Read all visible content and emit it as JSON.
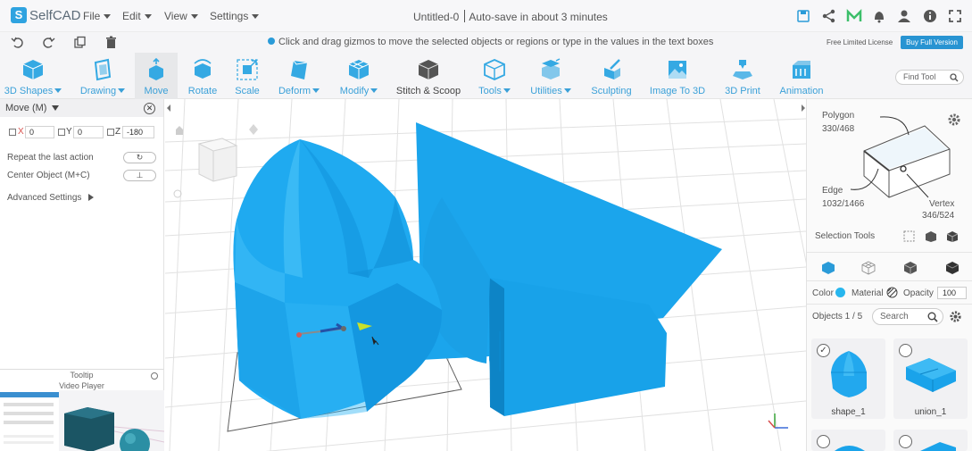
{
  "app": {
    "logo_text": "SelfCAD",
    "logo_mark": "S"
  },
  "menus": {
    "file": "File",
    "edit": "Edit",
    "view": "View",
    "settings": "Settings"
  },
  "document": {
    "title": "Untitled-0",
    "autosave": "Auto-save in about 3 minutes"
  },
  "hint": "Click and drag gizmos to move the selected objects or regions or type in the values in the text boxes",
  "license": {
    "text": "Free Limited License",
    "buy_label": "Buy Full Version"
  },
  "toolbar": {
    "shapes_3d": "3D Shapes",
    "drawing": "Drawing",
    "move": "Move",
    "rotate": "Rotate",
    "scale": "Scale",
    "deform": "Deform",
    "modify": "Modify",
    "stitch_scoop": "Stitch & Scoop",
    "tools": "Tools",
    "utilities": "Utilities",
    "sculpting": "Sculpting",
    "image_to_3d": "Image To 3D",
    "print_3d": "3D Print",
    "animation": "Animation",
    "find_tool_placeholder": "Find Tool"
  },
  "move_panel": {
    "title": "Move (M)",
    "x_label": "X",
    "x_value": "0",
    "y_label": "Y",
    "y_value": "0",
    "z_label": "Z",
    "z_value": "-180",
    "repeat_label": "Repeat the last action",
    "center_label": "Center Object (M+C)",
    "advanced_label": "Advanced Settings"
  },
  "tooltip_panel": {
    "title": "Tooltip",
    "subtitle": "Video Player"
  },
  "stats": {
    "polygon_label": "Polygon",
    "polygon_value": "330/468",
    "edge_label": "Edge",
    "edge_value": "1032/1466",
    "vertex_label": "Vertex",
    "vertex_value": "346/524"
  },
  "selection": {
    "label": "Selection Tools"
  },
  "appearance": {
    "color_label": "Color",
    "color_value": "#27b6ee",
    "material_label": "Material",
    "opacity_label": "Opacity",
    "opacity_value": "100"
  },
  "objects": {
    "header": "Objects 1 / 5",
    "search_placeholder": "Search",
    "items": [
      {
        "name": "shape_1",
        "checked": "✓"
      },
      {
        "name": "union_1",
        "checked": ""
      }
    ]
  },
  "colors": {
    "accent": "#2a9bd8",
    "model": "#1aa3ea",
    "buy_button": "#2894d2"
  }
}
